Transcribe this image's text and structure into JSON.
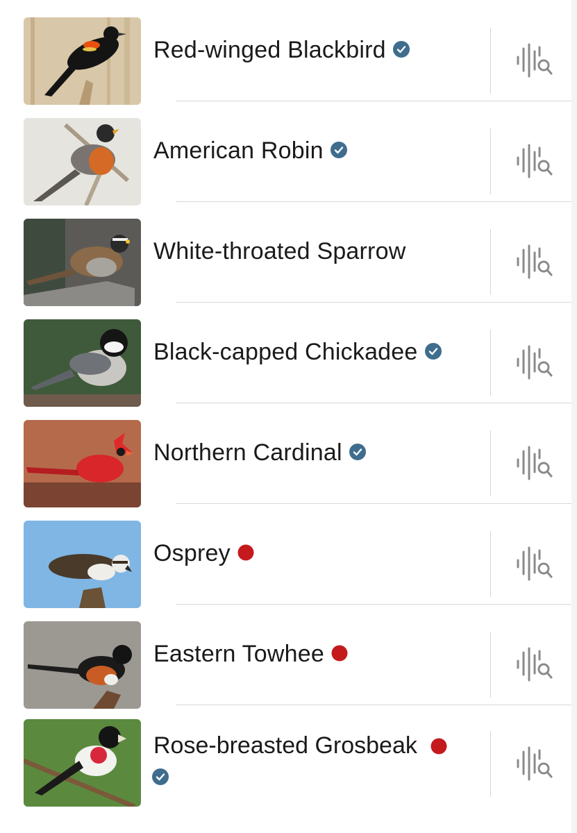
{
  "birds": [
    {
      "name": "Red-winged Blackbird",
      "status": "verified"
    },
    {
      "name": "American Robin",
      "status": "verified"
    },
    {
      "name": "White-throated Sparrow",
      "status": "none"
    },
    {
      "name": "Black-capped Chickadee",
      "status": "verified"
    },
    {
      "name": "Northern Cardinal",
      "status": "verified"
    },
    {
      "name": "Osprey",
      "status": "red-dot"
    },
    {
      "name": "Eastern Towhee",
      "status": "red-dot"
    },
    {
      "name": "Rose-breasted Grosbeak",
      "status": "red-dot-and-verified"
    }
  ],
  "icons": {
    "verified": "check-badge-icon",
    "red_dot": "red-dot-indicator",
    "sound": "sound-search-icon"
  },
  "colors": {
    "verified_badge": "#3f6d8e",
    "red_dot": "#c41a1e",
    "sound_icon": "#8a8a8a"
  }
}
